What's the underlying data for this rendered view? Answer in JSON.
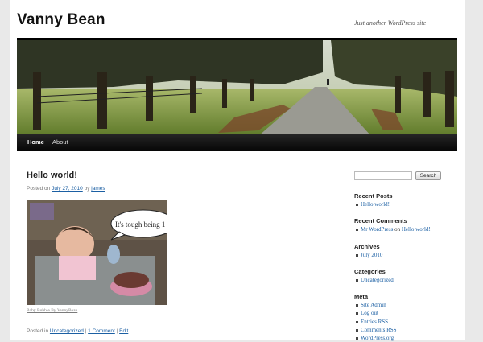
{
  "site": {
    "title": "Vanny Bean",
    "description": "Just another WordPress site"
  },
  "nav": {
    "items": [
      "Home",
      "About"
    ]
  },
  "post": {
    "title": "Hello world!",
    "meta": {
      "prefix": "Posted on",
      "date": "July 27, 2010",
      "by": "by",
      "author": "james"
    },
    "image_speech": "It's tough being 1",
    "caption": "Baby Bubble By VannyBean",
    "footer": {
      "prefix": "Posted in",
      "category": "Uncategorized",
      "sep1": "|",
      "comments": "1 Comment",
      "sep2": "|",
      "edit": "Edit"
    }
  },
  "sidebar": {
    "search_button": "Search",
    "search_value": "",
    "recent_posts": {
      "title": "Recent Posts",
      "items": [
        "Hello world!"
      ]
    },
    "recent_comments": {
      "title": "Recent Comments",
      "commenter": "Mr WordPress",
      "on": "on",
      "post": "Hello world!"
    },
    "archives": {
      "title": "Archives",
      "items": [
        "July 2010"
      ]
    },
    "categories": {
      "title": "Categories",
      "items": [
        "Uncategorized"
      ]
    },
    "meta": {
      "title": "Meta",
      "items": [
        "Site Admin",
        "Log out",
        "Entries RSS",
        "Comments RSS",
        "WordPress.org"
      ]
    }
  },
  "colors": {
    "link": "#1b5fa3",
    "nav_bg": "#0a0a0a",
    "page_bg": "#e9e9e9"
  }
}
